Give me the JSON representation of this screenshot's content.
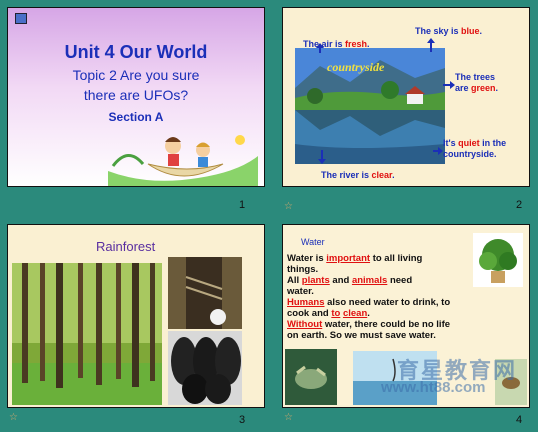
{
  "slides": [
    {
      "number": "1",
      "title": "Unit 4 Our World",
      "subtitle_line1": "Topic 2 Are you sure",
      "subtitle_line2": "there are UFOs?",
      "section": "Section A"
    },
    {
      "number": "2",
      "photo_caption": "countryside",
      "air": {
        "pre": "The air is ",
        "hl": "fresh",
        "post": "."
      },
      "sky": {
        "pre": "The sky is ",
        "hl": "blue",
        "post": "."
      },
      "trees": {
        "line1": "The trees",
        "pre": "are ",
        "hl": "green",
        "post": "."
      },
      "quiet": {
        "pre": "It's ",
        "hl": "quiet",
        "post": " in the",
        "line2": "countryside."
      },
      "river": {
        "pre": "The river is ",
        "hl": "clear",
        "post": "."
      }
    },
    {
      "number": "3",
      "heading": "Rainforest"
    },
    {
      "number": "4",
      "heading": "Water",
      "line1_pre": "Water is ",
      "line1_fill": "important",
      "line1_post": " to all living",
      "line2": "things.",
      "line3_pre": "All ",
      "line3_fill1": "plants",
      "line3_mid": " and ",
      "line3_fill2": "animals",
      "line3_post": " need",
      "line4": "water.",
      "line5_fill": "Humans",
      "line5_post": " also need water to drink, to",
      "line6_pre": "cook and ",
      "line6_fill1": "to",
      "line6_fill2": "clean",
      "line6_post": ".",
      "line7_fill": "Without",
      "line7_post": " water, there could be no life",
      "line8": "on earth. So we must save water.",
      "watermark1": "育星教育网",
      "watermark2": "www.ht88.com"
    }
  ]
}
